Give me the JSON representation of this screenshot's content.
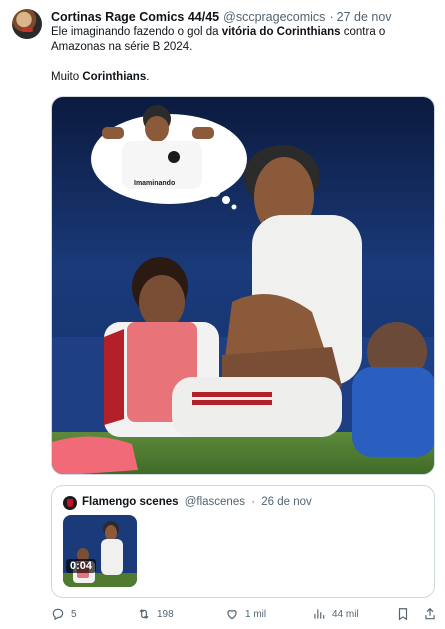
{
  "tweet": {
    "author_name": "Cortinas Rage Comics 44/45",
    "handle": "@sccpragecomics",
    "separator": "·",
    "date": "27 de nov",
    "text": {
      "p1_a": "Ele imaginando fazendo o gol da ",
      "p1_bold1": "vitória do Corinthians",
      "p1_b": " contra o Amazonas na série B 2024.",
      "p2_a": "Muito ",
      "p2_bold": "Corinthians",
      "p2_b": "."
    },
    "media": {
      "jersey_text": "Imaminando"
    }
  },
  "quote": {
    "author_name": "Flamengo scenes",
    "handle": "@flascenes",
    "separator": "·",
    "date": "26 de nov",
    "duration": "0:04"
  },
  "actions": {
    "reply_count": "5",
    "retweet_count": "198",
    "like_count": "1 mil",
    "views_count": "44 mil"
  },
  "colors": {
    "text_primary": "#0f1419",
    "text_secondary": "#536471",
    "border": "#cfd9de"
  },
  "icons": [
    "reply-icon",
    "retweet-icon",
    "like-icon",
    "views-icon",
    "bookmark-icon",
    "share-icon"
  ]
}
